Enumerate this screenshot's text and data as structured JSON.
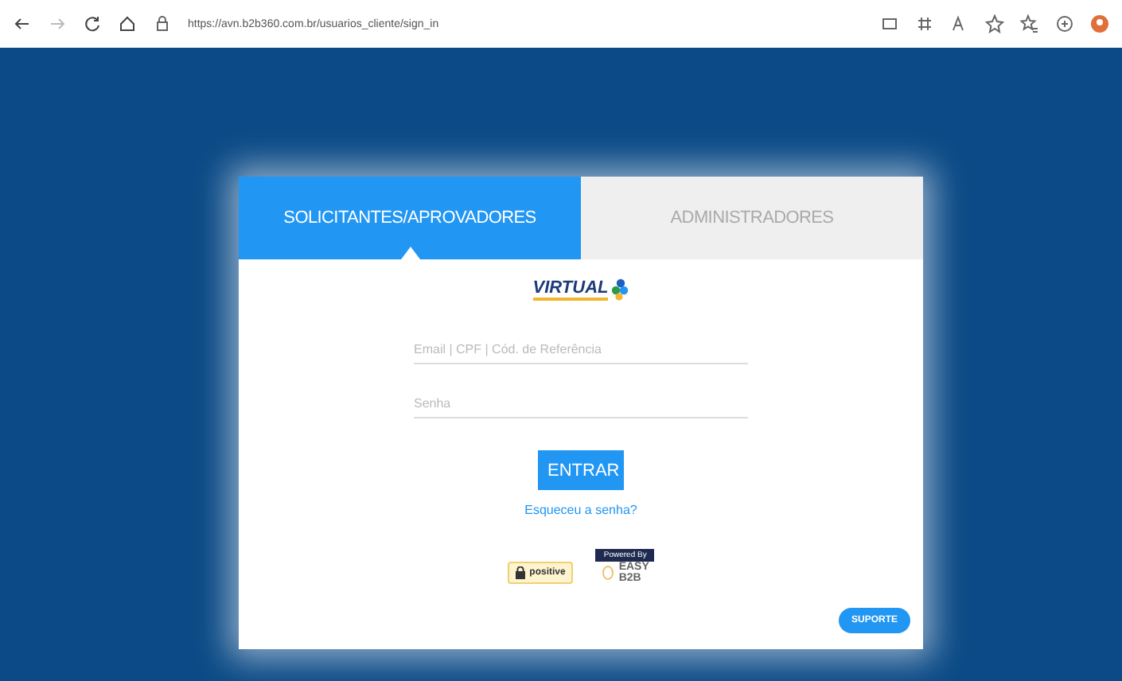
{
  "browser": {
    "url": "https://avn.b2b360.com.br/usuarios_cliente/sign_in"
  },
  "tabs": [
    {
      "label": "SOLICITANTES/APROVADORES",
      "selected": true
    },
    {
      "label": "ADMINISTRADORES",
      "selected": false
    }
  ],
  "logo": {
    "text": "VIRTUAL"
  },
  "form": {
    "login_placeholder": "Email | CPF | Cód. de Referência",
    "password_placeholder": "Senha",
    "submit": "ENTRAR",
    "forgot_link": "Esqueceu a senha?"
  },
  "badges": {
    "ssl": "positive",
    "powered_by": "Powered By",
    "brand_top": "EASY",
    "brand_bottom": "B2B"
  },
  "support_button": "SUPORTE"
}
